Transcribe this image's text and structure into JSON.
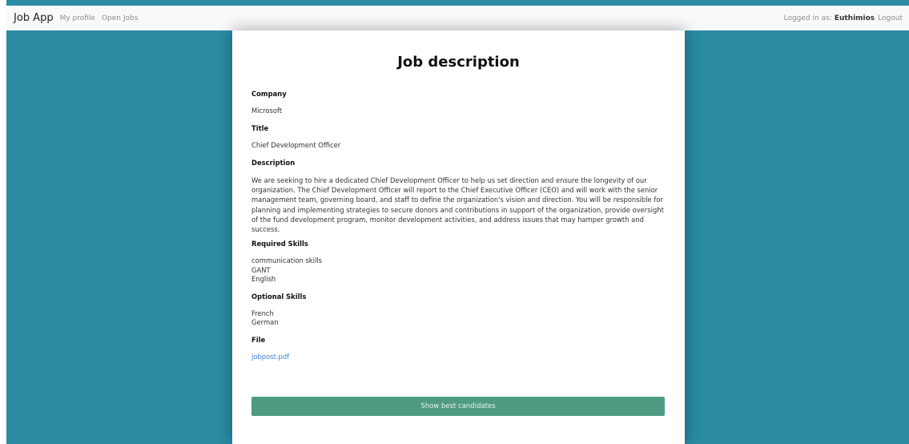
{
  "nav": {
    "brand": "Job App",
    "links": [
      "My profile",
      "Open Jobs"
    ],
    "logged_in_label": "Logged in as:",
    "user": "Euthimios",
    "logout": "Logout"
  },
  "job": {
    "page_title": "Job description",
    "company_label": "Company",
    "company": "Microsoft",
    "title_label": "Title",
    "title": "Chief Development Officer",
    "description_label": "Description",
    "description": "We are seeking to hire a dedicated Chief Development Officer to help us set direction and ensure the longevity of our organization. The Chief Development Officer will report to the Chief Executive Officer (CEO) and will work with the senior management team, governing board, and staff to define the organization's vision and direction. You will be responsible for planning and implementing strategies to secure donors and contributions in support of the organization, provide oversight of the fund development program, monitor development activities, and address issues that may hamper growth and success.",
    "required_skills_label": "Required Skills",
    "required_skills": [
      "communication skills",
      "GANT",
      "English"
    ],
    "optional_skills_label": "Optional Skills",
    "optional_skills": [
      "French",
      "German"
    ],
    "file_label": "File",
    "file": "jobpost.pdf",
    "action_button": "Show best candidates"
  },
  "colors": {
    "background": "#2a8ba3",
    "navbar": "#f8f9fa",
    "button": "#4f9a82",
    "link": "#3b82d6"
  }
}
